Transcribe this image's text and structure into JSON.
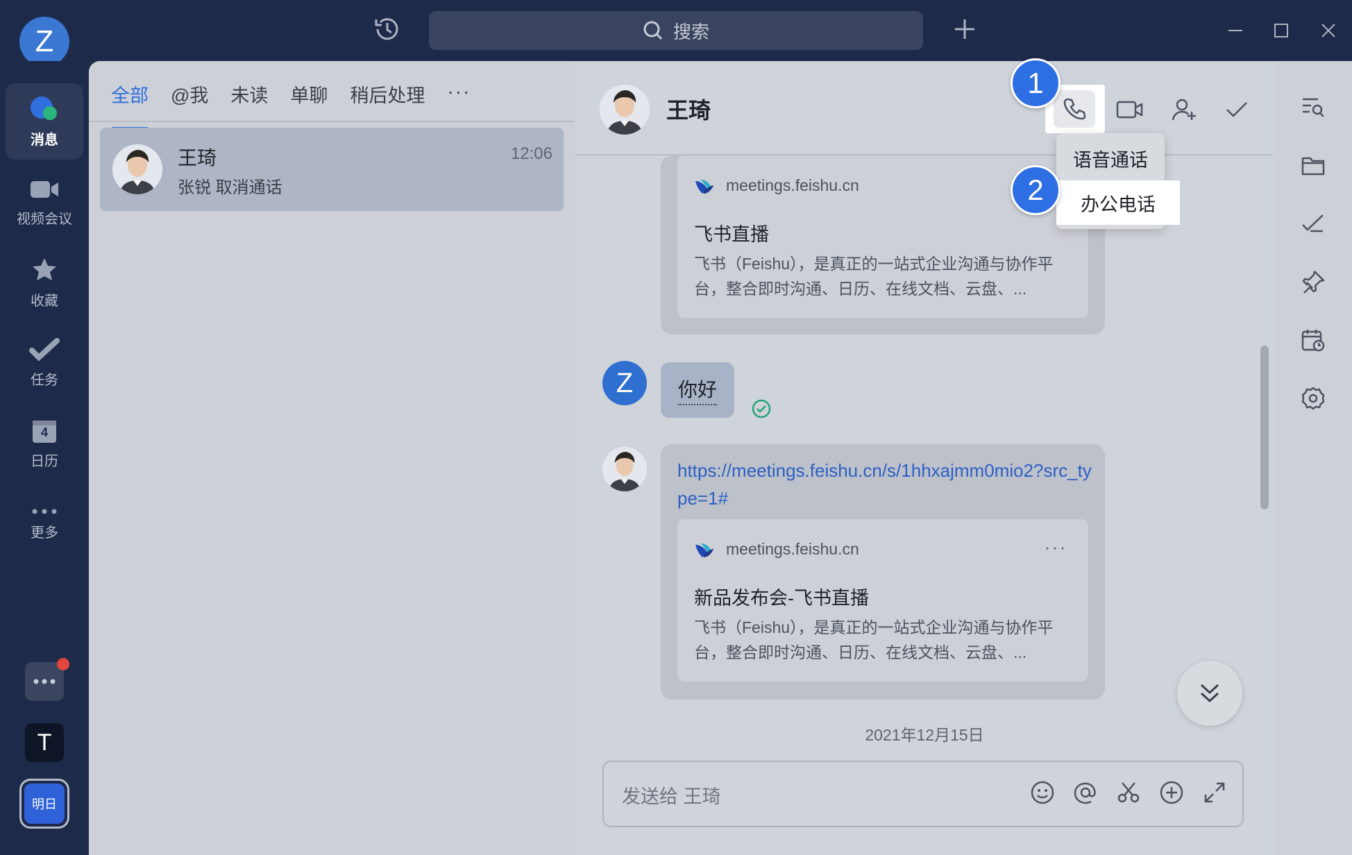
{
  "window": {
    "user_initial": "Z",
    "search_placeholder": "搜索"
  },
  "rail": {
    "items": [
      {
        "label": "消息",
        "icon": "chat-bubble-icon",
        "active": true
      },
      {
        "label": "视频会议",
        "icon": "video-camera-icon"
      },
      {
        "label": "收藏",
        "icon": "star-icon"
      },
      {
        "label": "任务",
        "icon": "task-check-icon"
      },
      {
        "label": "日历",
        "icon": "calendar-icon",
        "calendar_day": "4"
      },
      {
        "label": "更多",
        "icon": "more-dots-icon"
      }
    ],
    "bottom": {
      "app_t_label": "T",
      "tomorrow_label": "明日"
    }
  },
  "list": {
    "tabs": [
      "全部",
      "@我",
      "未读",
      "单聊",
      "稍后处理"
    ],
    "tab_more": "···",
    "chat": {
      "name": "王琦",
      "preview": "张锐 取消通话",
      "time": "12:06"
    }
  },
  "conversation": {
    "title": "王琦",
    "card1": {
      "site": "meetings.feishu.cn",
      "title": "飞书直播",
      "desc": "飞书（Feishu），是真正的一站式企业沟通与协作平台，整合即时沟通、日历、在线文档、云盘、..."
    },
    "message": {
      "sender_initial": "Z",
      "text": "你好"
    },
    "link_message": {
      "url": "https://meetings.feishu.cn/s/1hhxajmm0mio2?src_type=1#",
      "site": "meetings.feishu.cn",
      "more": "···",
      "title": "新品发布会-飞书直播",
      "desc": "飞书（Feishu），是真正的一站式企业沟通与协作平台，整合即时沟通、日历、在线文档、云盘、..."
    },
    "date_separator": "2021年12月15日",
    "composer_placeholder": "发送给 王琦"
  },
  "call_menu": {
    "items": [
      "语音通话",
      "办公电话"
    ],
    "highlighted": "办公电话"
  },
  "markers": [
    "1",
    "2"
  ],
  "colors": {
    "accent": "#2f6fde",
    "marker": "#2f6fe4",
    "rail_bg": "#1e2a4a"
  }
}
